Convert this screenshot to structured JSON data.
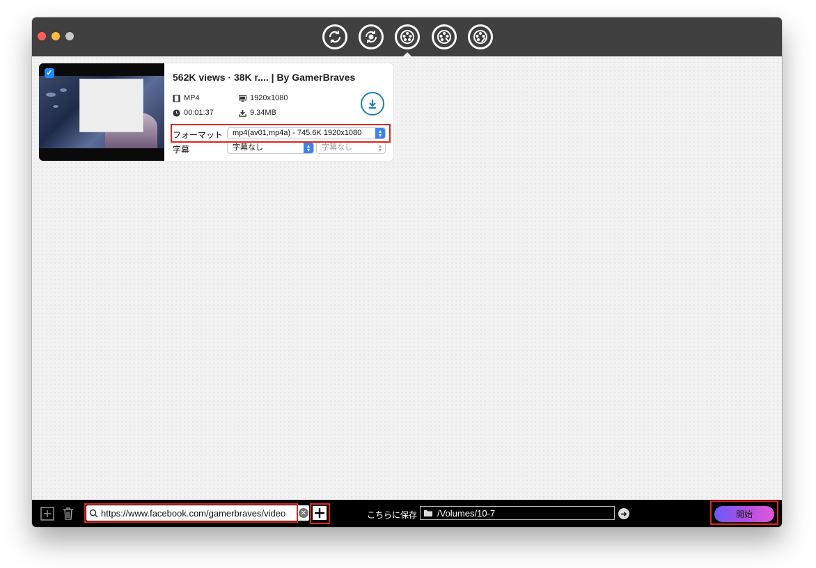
{
  "toolbar": {
    "tools": [
      "convert-icon",
      "transfer-icon",
      "download-icon",
      "edit-icon",
      "repair-icon"
    ],
    "active_tool": "download-icon"
  },
  "video": {
    "title": "562K views · 38K r.... | By GamerBraves",
    "format": "MP4",
    "resolution": "1920x1080",
    "duration": "00:01:37",
    "size": "9.34MB",
    "checked": true
  },
  "format_row": {
    "label": "フォーマット",
    "value": "mp4(av01,mp4a) - 745.6K 1920x1080"
  },
  "subtitle_row": {
    "label": "字幕",
    "value": "字幕なし",
    "secondary_value": "字幕なし"
  },
  "bottom": {
    "url_value": "https://www.facebook.com/gamerbraves/video",
    "save_label": "こちらに保存",
    "path_value": "/Volumes/10-7",
    "start_label": "開始"
  },
  "colors": {
    "titlebar": "#404040",
    "accent_blue": "#1a7fc4",
    "highlight_red": "#e3241b"
  }
}
